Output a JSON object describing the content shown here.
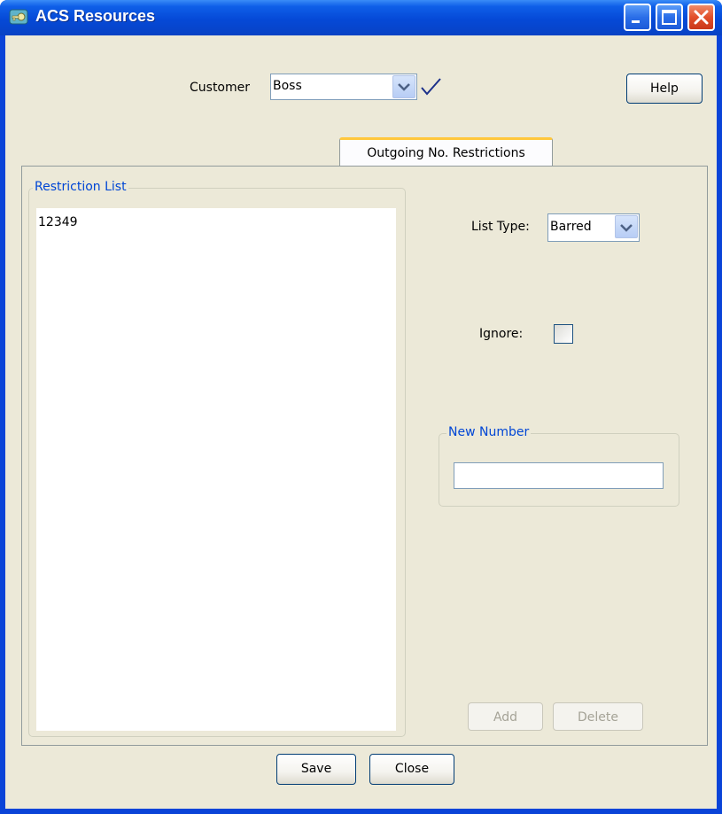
{
  "window": {
    "title": "ACS Resources",
    "icons": [
      "app-key-icon",
      "minimize-icon",
      "maximize-icon",
      "close-icon"
    ]
  },
  "header": {
    "customer_label": "Customer",
    "customer_value": "Boss",
    "confirm_icon": "checkmark-icon",
    "help_label": "Help"
  },
  "tabs": [
    {
      "label": "Outgoing No. Restrictions",
      "selected": true
    }
  ],
  "restriction_list": {
    "title": "Restriction List",
    "items": [
      "12349"
    ]
  },
  "list_type": {
    "label": "List Type:",
    "value": "Barred"
  },
  "ignore": {
    "label": "Ignore:",
    "checked": false
  },
  "new_number": {
    "title": "New Number",
    "value": ""
  },
  "actions": {
    "add_label": "Add",
    "delete_label": "Delete"
  },
  "footer": {
    "save_label": "Save",
    "close_label": "Close"
  },
  "colors": {
    "titlebar": "#0549d7",
    "group_title": "#0046d5",
    "tab_highlight": "#ffc73c",
    "background": "#ece9d8"
  }
}
